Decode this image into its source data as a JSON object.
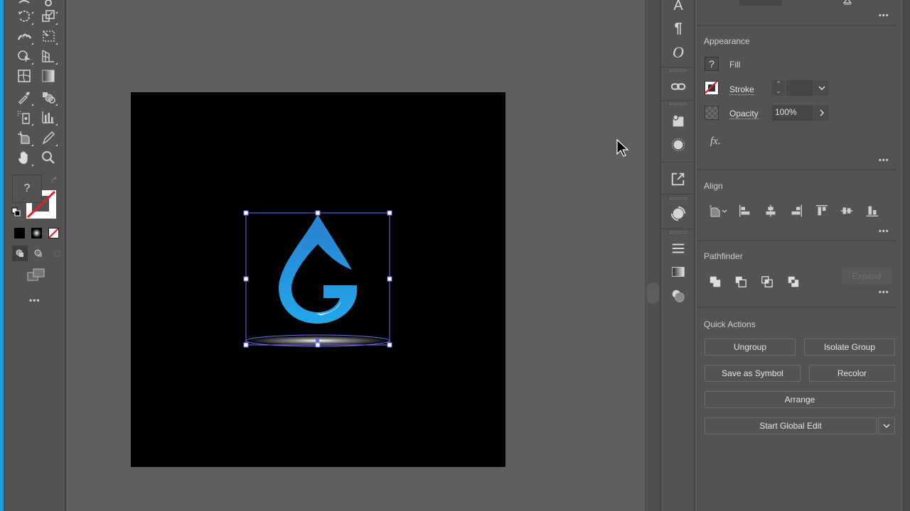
{
  "app": "Adobe Illustrator",
  "toolbar": {
    "tools": [
      "rotate-tool",
      "scale-tool",
      "puppet-warp-tool",
      "free-transform-tool",
      "shape-builder-tool",
      "perspective-grid-tool",
      "mesh-tool",
      "gradient-tool",
      "eyedropper-tool",
      "blend-tool",
      "symbol-sprayer-tool",
      "column-graph-tool",
      "artboard-tool",
      "slice-tool",
      "hand-tool",
      "zoom-tool"
    ],
    "fill_label": "?",
    "more_label": "•••"
  },
  "right_strip": {
    "icons": [
      "character-icon",
      "paragraph-icon",
      "opentype-icon",
      "links-icon",
      "symbols-icon",
      "brushes-icon",
      "export-icon",
      "color-guide-icon",
      "stroke-panel-icon",
      "gradient-panel-icon",
      "transparency-icon"
    ]
  },
  "properties": {
    "top_more": "•••",
    "appearance": {
      "title": "Appearance",
      "fill_swatch": "?",
      "fill_label": "Fill",
      "stroke_label": "Stroke",
      "stroke_value": "",
      "opacity_label": "Opacity",
      "opacity_value": "100%",
      "fx_label": "fx.",
      "more": "•••"
    },
    "align": {
      "title": "Align",
      "more": "•••"
    },
    "pathfinder": {
      "title": "Pathfinder",
      "expand_label": "Expand",
      "more": "•••"
    },
    "quick_actions": {
      "title": "Quick Actions",
      "ungroup": "Ungroup",
      "isolate_group": "Isolate Group",
      "save_as_symbol": "Save as Symbol",
      "recolor": "Recolor",
      "arrange": "Arrange",
      "start_global_edit": "Start Global Edit"
    }
  },
  "colors": {
    "accent": "#1ea0e6",
    "logo_top": "#2b7fd0",
    "logo_bottom": "#22a8ea",
    "selection": "#6e6eff",
    "artboard": "#000000"
  }
}
